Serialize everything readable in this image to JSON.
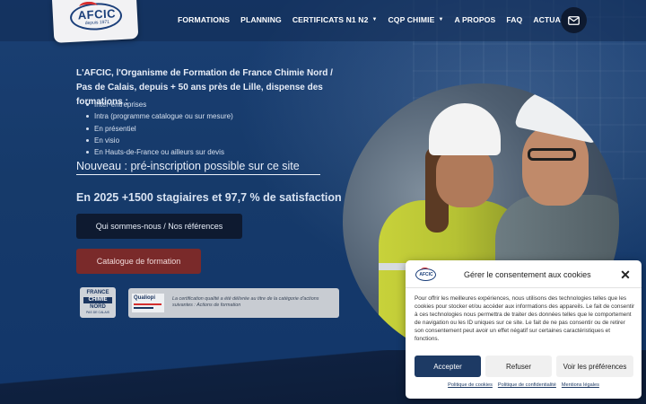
{
  "header": {
    "logo": {
      "name": "AFCIC",
      "tagline": "depuis 1971"
    },
    "nav": [
      {
        "label": "FORMATIONS",
        "dropdown": false
      },
      {
        "label": "PLANNING",
        "dropdown": false
      },
      {
        "label": "CERTIFICATS N1 N2",
        "dropdown": true
      },
      {
        "label": "CQP CHIMIE",
        "dropdown": true
      },
      {
        "label": "A PROPOS",
        "dropdown": false
      },
      {
        "label": "FAQ",
        "dropdown": false
      },
      {
        "label": "ACTUALITÉS",
        "dropdown": false
      }
    ],
    "caret_glyph": "▼",
    "mail_icon": "envelope-icon"
  },
  "hero": {
    "intro": "L'AFCIC, l'Organisme de Formation de France Chimie Nord / Pas de Calais, depuis + 50 ans près de Lille, dispense des formations :",
    "bullets": [
      "Inter-entreprises",
      "Intra (programme catalogue ou sur mesure)",
      "En présentiel",
      "En visio",
      "En Hauts-de-France ou ailleurs sur devis"
    ],
    "news": "Nouveau : pré-inscription possible sur ce site",
    "stats": "En 2025  +1500 stagiaires et 97,7 % de satisfaction",
    "btn_about": "Qui sommes-nous / Nos références",
    "btn_catalog": "Catalogue de formation"
  },
  "certifications": {
    "france_chimie": {
      "top": "FRANCE",
      "mid": "CHIMIE",
      "bottom": "NORD",
      "small": "PAS DE CALAIS"
    },
    "qualiopi": {
      "name": "Qualiopi",
      "text": "La certification qualité a été délivrée au titre de la catégorie d'actions suivantes : Actions de formation"
    }
  },
  "cookie": {
    "logo": "AFCIC",
    "title": "Gérer le consentement aux cookies",
    "body": "Pour offrir les meilleures expériences, nous utilisons des technologies telles que les cookies pour stocker et/ou accéder aux informations des appareils. Le fait de consentir à ces technologies nous permettra de traiter des données telles que le comportement de navigation ou les ID uniques sur ce site. Le fait de ne pas consentir ou de retirer son consentement peut avoir un effet négatif sur certaines caractéristiques et fonctions.",
    "accept": "Accepter",
    "refuse": "Refuser",
    "prefs": "Voir les préférences",
    "links": [
      "Politique de cookies",
      "Politique de confidentialité",
      "Mentions légales"
    ],
    "close_glyph": "✕"
  },
  "colors": {
    "background": "#163a6a",
    "dark_button": "#0e1a30",
    "catalog_button": "#7a2a2a",
    "accept_button": "#1d3a64"
  }
}
